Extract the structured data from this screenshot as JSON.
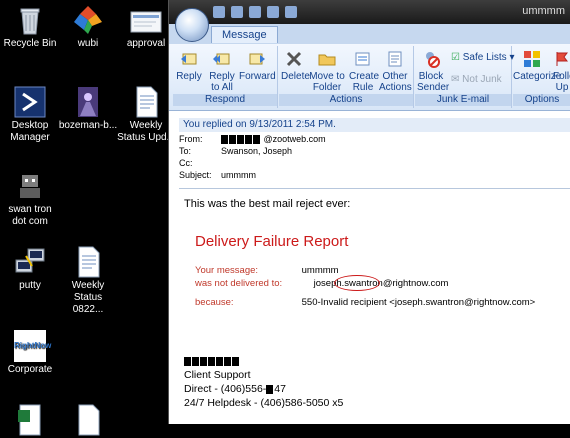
{
  "desktop": {
    "icons": [
      {
        "label": "Recycle Bin"
      },
      {
        "label": "wubi"
      },
      {
        "label": "approval"
      },
      {
        "label": "Desktop Manager"
      },
      {
        "label": "bozeman-b..."
      },
      {
        "label": "Weekly Status Upd..."
      },
      {
        "label": "swan tron dot com"
      },
      {
        "label": "putty"
      },
      {
        "label": "Weekly Status 0822..."
      },
      {
        "label": "Corporate"
      },
      {
        "label": "RightNow"
      }
    ]
  },
  "window": {
    "title": "ummmm",
    "tab": "Message",
    "groups": {
      "respond": {
        "label": "Respond",
        "reply": "Reply",
        "reply_all": "Reply to All",
        "forward": "Forward"
      },
      "actions": {
        "label": "Actions",
        "delete": "Delete",
        "move": "Move to Folder",
        "create_rule": "Create Rule",
        "other": "Other Actions"
      },
      "junk": {
        "label": "Junk E-mail",
        "block": "Block Sender",
        "safe_lists": "Safe Lists",
        "not_junk": "Not Junk"
      },
      "options": {
        "label": "Options",
        "categorize": "Categorize",
        "follow_up": "Follow Up"
      }
    }
  },
  "message": {
    "info": "You replied on 9/13/2011 2:54 PM.",
    "from_label": "From:",
    "from_value": "@zootweb.com",
    "to_label": "To:",
    "to_value": "Swanson, Joseph",
    "cc_label": "Cc:",
    "subject_label": "Subject:",
    "subject_value": "ummmm"
  },
  "body": {
    "intro": "This was the best mail reject ever:",
    "report_title": "Delivery Failure Report",
    "your_message_label": "Your message:",
    "your_message_value": "ummmm",
    "not_delivered_label": "was not delivered to:",
    "not_delivered_value": "joseph.swantron@rightnow.com",
    "because_label": "because:",
    "because_value": "550-Invalid recipient <joseph.swantron@rightnow.com>",
    "sig_line1": "Client Support",
    "sig_line2": "Direct - (406)556-",
    "sig_line2_end": "47",
    "sig_line3": "24/7 Helpdesk - (406)586-5050 x5"
  }
}
